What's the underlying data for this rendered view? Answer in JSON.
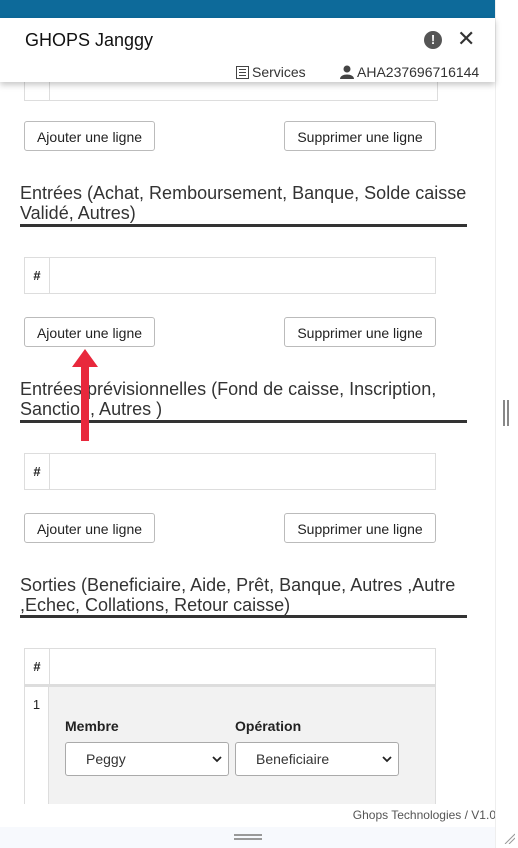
{
  "header": {
    "title": "GHOPS Janggy",
    "services_label": "Services",
    "user_label": "AHA237696716144"
  },
  "sections": {
    "prev_add": "Ajouter une ligne",
    "prev_del": "Supprimer une ligne",
    "entrees": {
      "title": "Entrées (Achat, Remboursement, Banque, Solde caisse Validé, Autres)",
      "hash": "#",
      "add": "Ajouter une ligne",
      "del": "Supprimer une ligne"
    },
    "previsions": {
      "title": "Entrées prévisionnelles (Fond de caisse, Inscription, Sanction, Autres )",
      "hash": "#",
      "add": "Ajouter une ligne",
      "del": "Supprimer une ligne"
    },
    "sorties": {
      "title": "Sorties (Beneficiaire, Aide, Prêt, Banque, Autres ,Autre ,Echec, Collations, Retour caisse)",
      "hash": "#",
      "row_index": "1",
      "membre_label": "Membre",
      "membre_value": "Peggy",
      "operation_label": "Opération",
      "operation_value": "Beneficiaire"
    }
  },
  "footer": {
    "credit": "Ghops Technologies / V1.0"
  },
  "colors": {
    "topbar": "#0d6a9a",
    "annotation_arrow": "#e8283c"
  }
}
